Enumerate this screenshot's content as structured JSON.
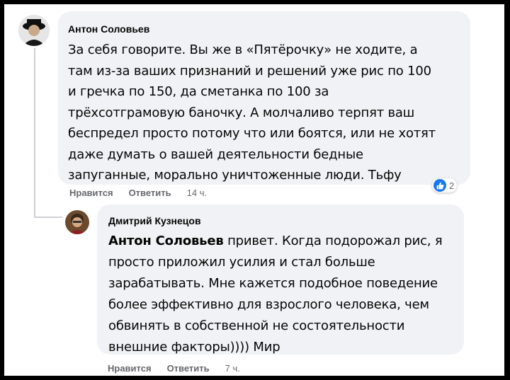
{
  "comments": [
    {
      "author": "Антон Соловьев",
      "lines": [
        "За себя говорите. Вы же в «Пятёрочку» не ходите, а",
        "там из-за ваших признаний и решений уже рис по 100",
        "и гречка по 150, да сметанка по 100 за",
        "трёхсотграмовую баночку. А молчаливо терпят ваш",
        "беспредел просто потому что или боятся, или не хотят",
        "даже думать о вашей деятельности бедные",
        "запуганные, морально уничтоженные люди. Тьфу"
      ],
      "like_label": "Нравится",
      "reply_label": "Ответить",
      "time": "14 ч.",
      "reaction_count": "2"
    },
    {
      "author": "Дмитрий Кузнецов",
      "mention": "Антон Соловьев",
      "first_line_rest": " привет. Когда подорожал рис, я",
      "lines": [
        "просто приложил усилия и стал больше",
        "зарабатывать. Мне кажется подобное поведение",
        "более эффективно для взрослого человека, чем",
        "обвинять в собственной не состоятельности",
        "внешние факторы)))) Мир"
      ],
      "like_label": "Нравится",
      "reply_label": "Ответить",
      "time": "7 ч."
    }
  ],
  "colors": {
    "bubble": "#f0f2f5",
    "like_blue": "#1877f2",
    "meta_gray": "#65676b"
  }
}
